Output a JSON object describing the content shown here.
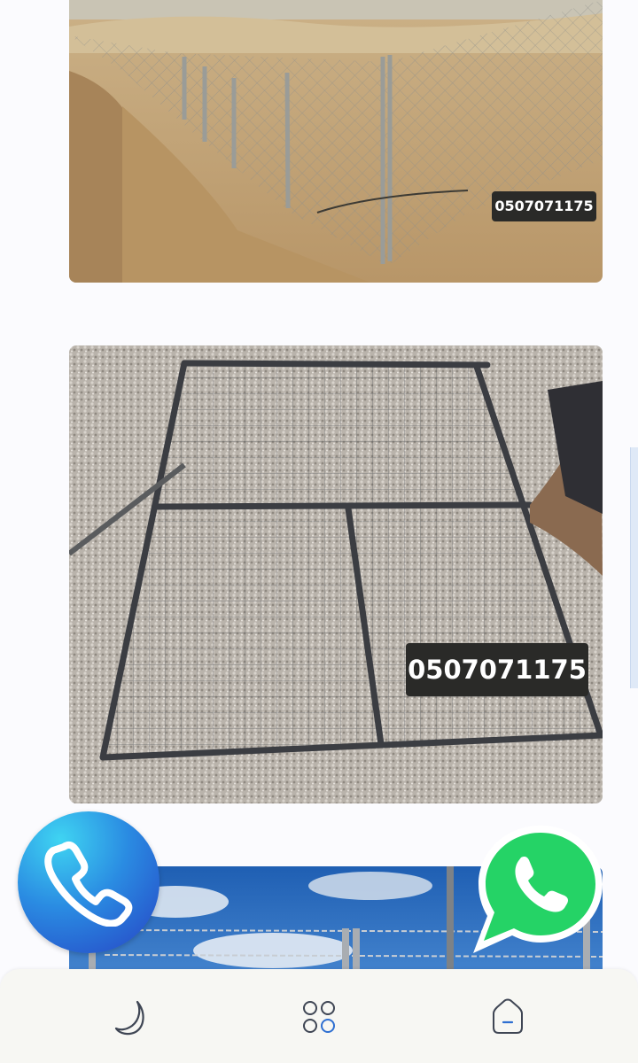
{
  "photos": [
    {
      "id": "desert-chain-link-fence",
      "phone_watermark": "0507071175"
    },
    {
      "id": "welded-steel-gate-frame",
      "phone_watermark": "0507071175"
    },
    {
      "id": "barbed-wire-fence-sky"
    }
  ],
  "floating_buttons": {
    "call": {
      "icon": "phone-icon",
      "color_from": "#3fd4f2",
      "color_to": "#2643c4"
    },
    "whatsapp": {
      "icon": "whatsapp-icon",
      "color": "#25d366"
    }
  },
  "bottom_nav": {
    "items": [
      {
        "icon": "moon-icon"
      },
      {
        "icon": "apps-grid-icon"
      },
      {
        "icon": "home-icon"
      }
    ]
  },
  "colors": {
    "accent": "#2e6fd1",
    "nav_bg": "#f7f7f3",
    "page_bg": "#fbfbfe"
  }
}
